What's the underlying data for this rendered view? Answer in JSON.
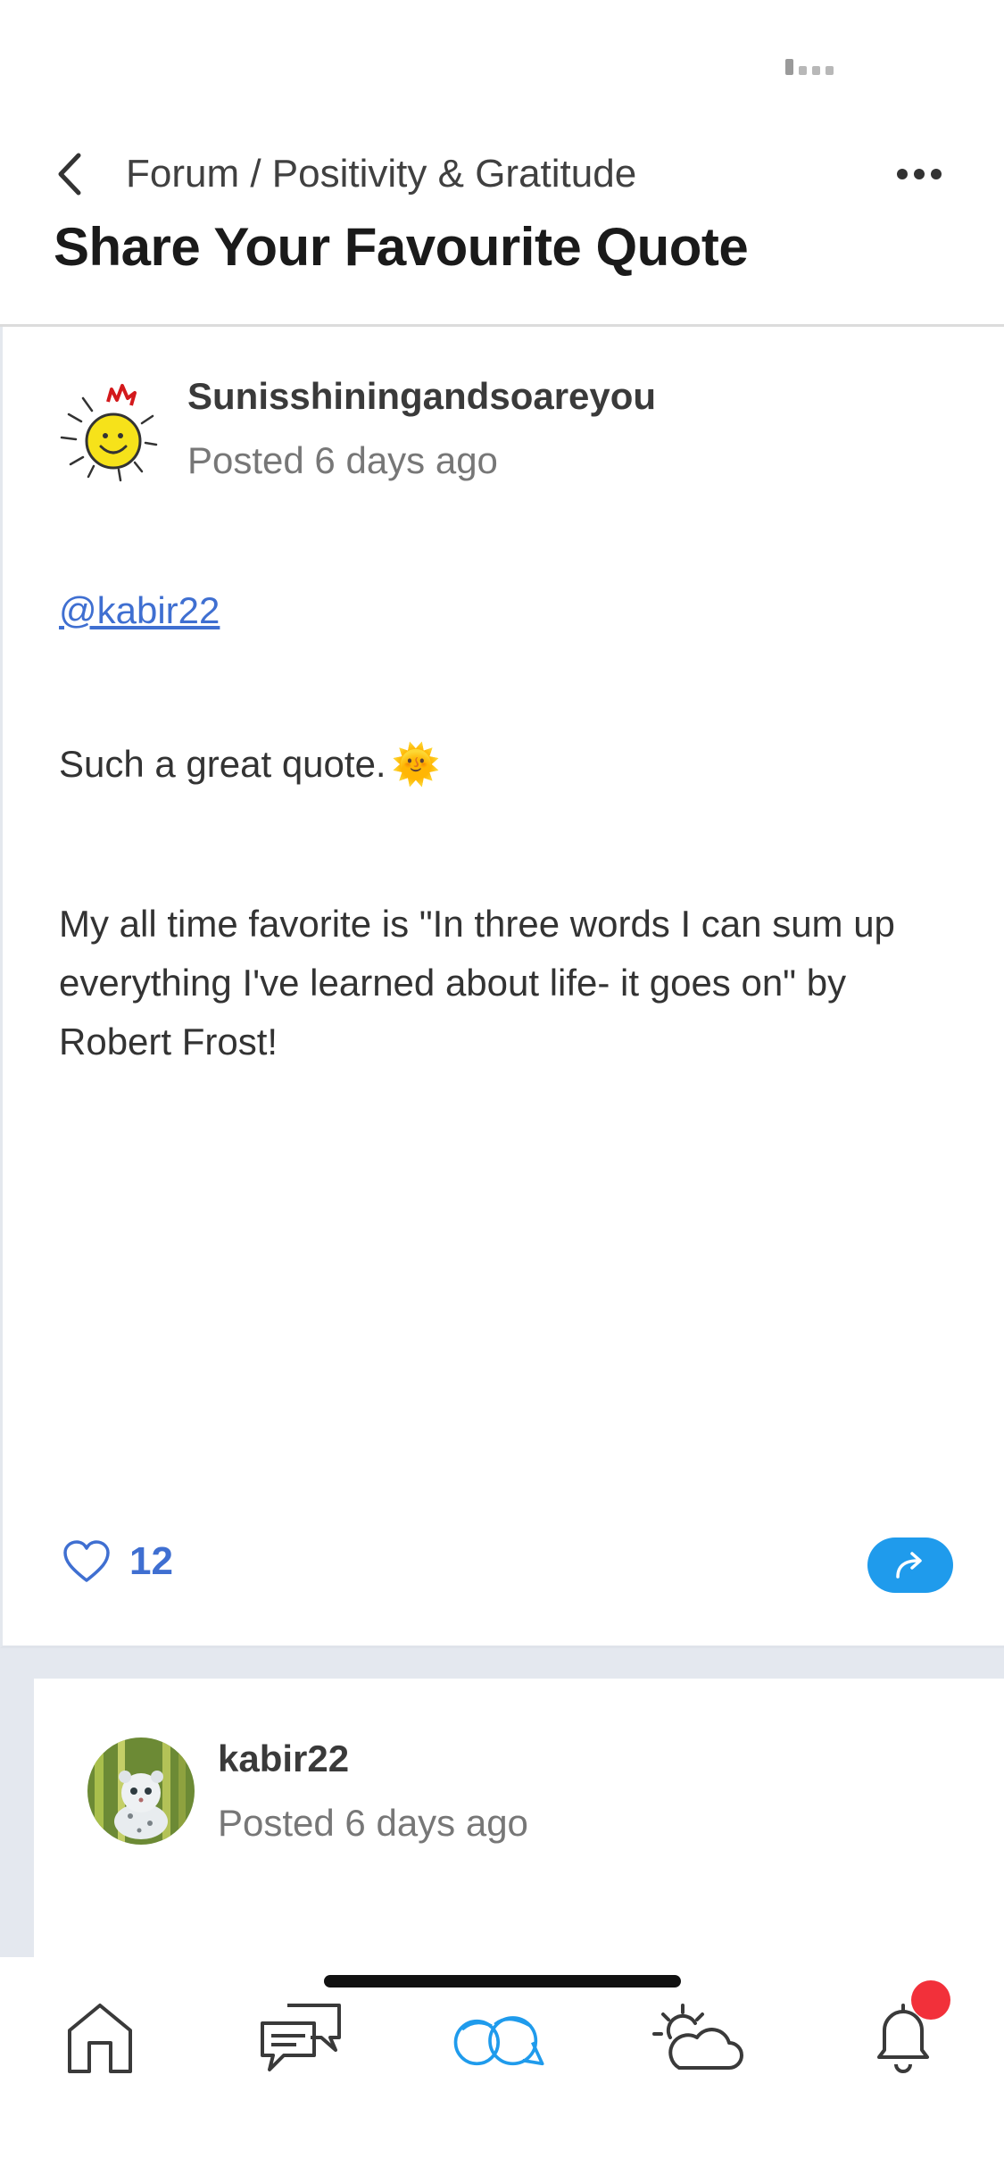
{
  "header": {
    "breadcrumb": "Forum / Positivity & Gratitude",
    "title": "Share Your Favourite Quote"
  },
  "posts": [
    {
      "author": "Sunisshiningandsoareyou",
      "posted": "Posted 6 days ago",
      "mention": "@kabir22",
      "paragraph1": "Such a great quote.",
      "paragraph1_emoji": "🌞",
      "paragraph2": "My all time favorite is \"In three words I can sum up everything I've learned about life- it goes on\" by Robert Frost!",
      "likes": "12"
    },
    {
      "author": "kabir22",
      "posted": "Posted 6 days ago"
    }
  ],
  "nav": {
    "items": [
      "home-icon",
      "chat-icon",
      "community-icon",
      "weather-icon",
      "bell-icon"
    ],
    "active": "community-icon",
    "accent_color": "#1f9bec",
    "badge_color": "#f2303a"
  }
}
